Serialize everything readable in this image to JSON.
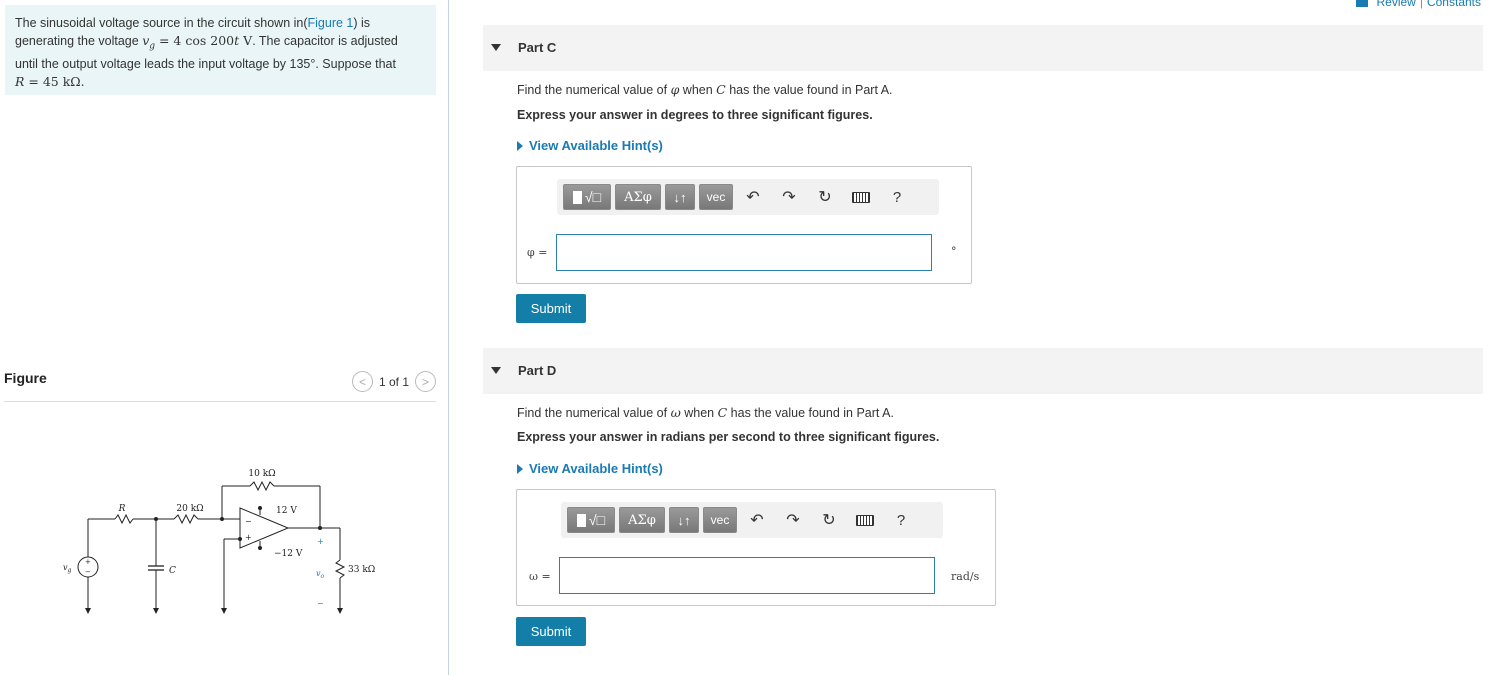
{
  "top_links": {
    "review": "Review",
    "separator": "|",
    "constants": "Constants"
  },
  "problem": {
    "line1_pre": "The sinusoidal voltage source in the circuit shown in(",
    "figure_link": "Figure 1",
    "line1_post": ") is",
    "line2_pre": "generating the voltage ",
    "line2_math": "v_g = 4 cos 200t V",
    "line2_post": ". The capacitor is adjusted",
    "line3": "until the output voltage leads the input voltage by 135°. Suppose that",
    "line4_math": "R = 45 kΩ."
  },
  "figure": {
    "title": "Figure",
    "pager": "1 of 1",
    "circuit_labels": {
      "r_top": "10 kΩ",
      "r_left": "R",
      "r_mid": "20 kΩ",
      "vpos": "12 V",
      "vneg": "−12 V",
      "vg": "v_g",
      "cap": "C",
      "vo": "v_o",
      "r_load": "33 kΩ",
      "plus": "+",
      "minus": "−"
    }
  },
  "parts": [
    {
      "label": "Part C",
      "question_pre": "Find the numerical value of ",
      "question_var": "φ",
      "question_mid": " when ",
      "question_c": "C",
      "question_post": " has the value found in Part A.",
      "instruction": "Express your answer in degrees to three significant figures.",
      "hint": "View Available Hint(s)",
      "variable": "φ =",
      "input_value": "",
      "unit": "°",
      "submit": "Submit"
    },
    {
      "label": "Part D",
      "question_pre": "Find the numerical value of ",
      "question_var": "ω",
      "question_mid": " when ",
      "question_c": "C",
      "question_post": " has the value found in Part A.",
      "instruction": "Express your answer in radians per second to three significant figures.",
      "hint": "View Available Hint(s)",
      "variable": "ω =",
      "input_value": "",
      "unit": "rad/s",
      "submit": "Submit"
    }
  ],
  "toolbar": {
    "greek": "ΑΣφ",
    "sort": "↓↑",
    "vec": "vec",
    "help": "?",
    "undo": "↶",
    "redo": "↷",
    "reset": "↻"
  }
}
